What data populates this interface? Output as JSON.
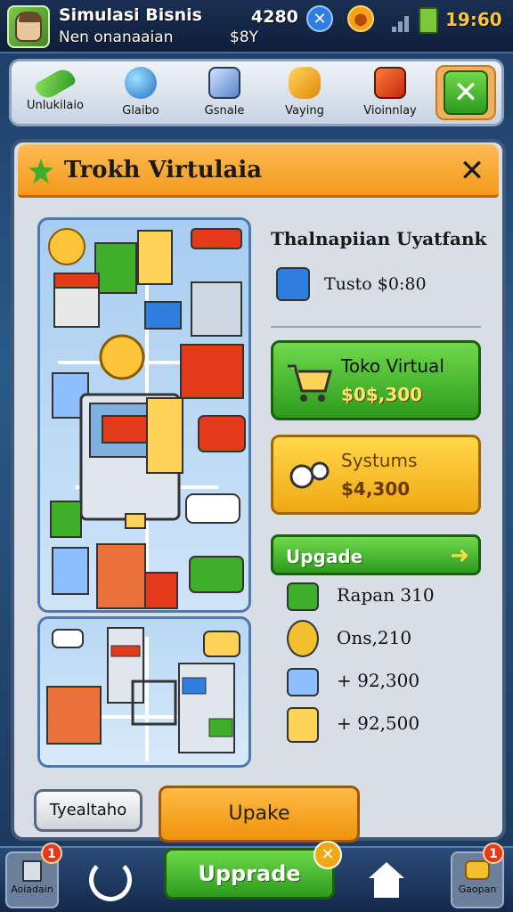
{
  "header": {
    "player_name": "Simulasi Bisnis",
    "player_sub": "Nen onanaaian",
    "money_primary": "4280",
    "money_secondary": "$8Y",
    "time": "19:60"
  },
  "tabs": [
    {
      "label": "Unlukilaio"
    },
    {
      "label": "Glaibo"
    },
    {
      "label": "Gsnale"
    },
    {
      "label": "Vaying"
    },
    {
      "label": "Vioinnlay"
    }
  ],
  "panel": {
    "title": "Trokh Virtulaia",
    "info_heading": "Thalnapiian Uyatfank",
    "info_line": "Tusto $0:80",
    "buttons": [
      {
        "line1": "Toko Virtual",
        "line2": "$0$,300",
        "color": "#3fae2a"
      },
      {
        "line1": "Systums",
        "line2": "$4,300",
        "color": "#f0b020"
      }
    ],
    "upgrade_label": "Upgade",
    "stats": [
      {
        "text": "Rapan 310"
      },
      {
        "text": "Ons,210"
      },
      {
        "text": "+ 92,300"
      },
      {
        "text": "+ 92,500"
      }
    ],
    "secondary_button": "Tyealtaho",
    "primary_button": "Upake"
  },
  "bottom_nav": {
    "left_label": "Aoiadain",
    "left_badge": "1",
    "upgrade_label": "Upprade",
    "right_label": "Gaopan",
    "right_badge": "1"
  }
}
